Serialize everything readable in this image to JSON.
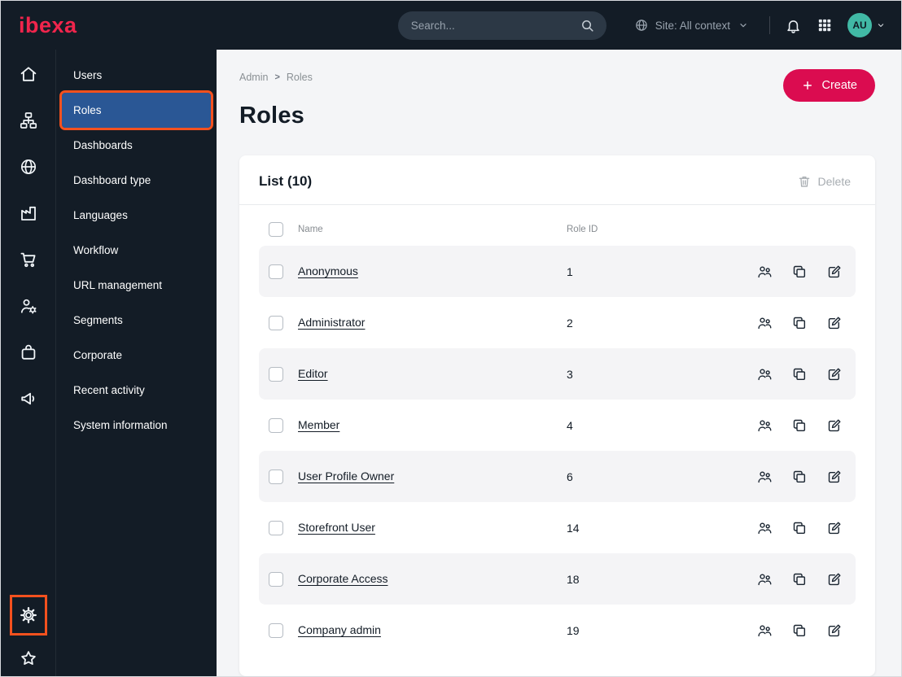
{
  "topbar": {
    "logo_text": "ibexa",
    "search_placeholder": "Search...",
    "site_context_label": "Site: All context",
    "avatar_initials": "AU"
  },
  "sidebar": {
    "items": [
      {
        "label": "Users",
        "selected": false
      },
      {
        "label": "Roles",
        "selected": true
      },
      {
        "label": "Dashboards",
        "selected": false
      },
      {
        "label": "Dashboard type",
        "selected": false
      },
      {
        "label": "Languages",
        "selected": false
      },
      {
        "label": "Workflow",
        "selected": false
      },
      {
        "label": "URL management",
        "selected": false
      },
      {
        "label": "Segments",
        "selected": false
      },
      {
        "label": "Corporate",
        "selected": false
      },
      {
        "label": "Recent activity",
        "selected": false
      },
      {
        "label": "System information",
        "selected": false
      }
    ]
  },
  "main": {
    "breadcrumb": {
      "items": [
        "Admin",
        "Roles"
      ],
      "separator": ">"
    },
    "create_button_label": "Create",
    "page_title": "Roles",
    "card": {
      "list_title": "List (10)",
      "delete_button_label": "Delete",
      "columns": [
        "Name",
        "Role ID"
      ],
      "rows": [
        {
          "name": "Anonymous",
          "role_id": "1"
        },
        {
          "name": "Administrator",
          "role_id": "2"
        },
        {
          "name": "Editor",
          "role_id": "3"
        },
        {
          "name": "Member",
          "role_id": "4"
        },
        {
          "name": "User Profile Owner",
          "role_id": "6"
        },
        {
          "name": "Storefront User",
          "role_id": "14"
        },
        {
          "name": "Corporate Access",
          "role_id": "18"
        },
        {
          "name": "Company admin",
          "role_id": "19"
        }
      ]
    }
  },
  "icons": {
    "topbar": [
      "search-icon",
      "globe-icon",
      "chevron-down-icon",
      "bell-icon",
      "app-grid-icon"
    ],
    "rail": [
      "home-icon",
      "content-tree-icon",
      "site-globe-icon",
      "company-icon",
      "cart-icon",
      "admin-gear-person-icon",
      "product-bag-icon",
      "megaphone-icon",
      "gear-icon",
      "star-icon"
    ],
    "row_actions": [
      "assign-user-icon",
      "copy-icon",
      "edit-icon"
    ],
    "other": [
      "plus-icon",
      "trash-icon"
    ]
  },
  "colors": {
    "dark_navy": "#131C26",
    "accent_red": "#DB0C50",
    "logo_red": "#F0254C",
    "annotation_orange": "#F4511E",
    "selected_blue": "#2A5795",
    "avatar_teal": "#41B9A5",
    "main_background": "#F4F5F7",
    "stripe_gray": "#F4F4F6"
  }
}
